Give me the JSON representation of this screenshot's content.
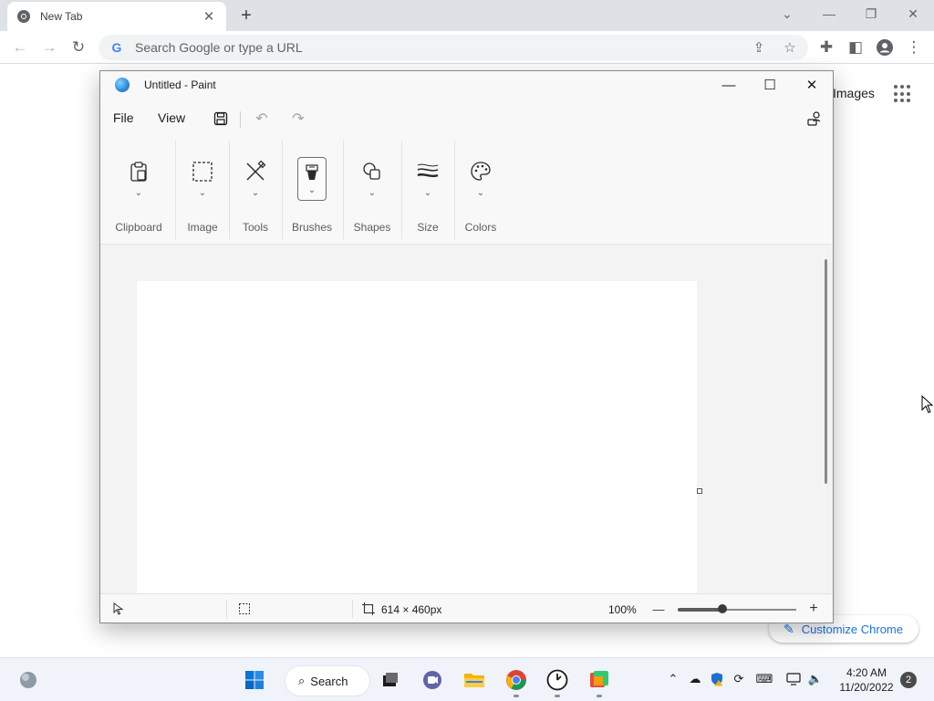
{
  "chrome": {
    "tab_title": "New Tab",
    "omnibox_placeholder": "Search Google or type a URL",
    "google_g": "G",
    "images_link": "Images",
    "customize_label": "Customize Chrome"
  },
  "paint": {
    "window_title": "Untitled - Paint",
    "menu": {
      "file": "File",
      "view": "View"
    },
    "ribbon": [
      {
        "label": "Clipboard",
        "icon": "clipboard-icon"
      },
      {
        "label": "Image",
        "icon": "selection-icon"
      },
      {
        "label": "Tools",
        "icon": "tools-icon"
      },
      {
        "label": "Brushes",
        "icon": "brush-icon"
      },
      {
        "label": "Shapes",
        "icon": "shapes-icon"
      },
      {
        "label": "Size",
        "icon": "size-icon"
      },
      {
        "label": "Colors",
        "icon": "palette-icon"
      }
    ],
    "status": {
      "canvas_size": "614 × 460px",
      "zoom": "100%"
    }
  },
  "taskbar": {
    "search_label": "Search",
    "time": "4:20 AM",
    "date": "11/20/2022",
    "notification_count": "2"
  }
}
